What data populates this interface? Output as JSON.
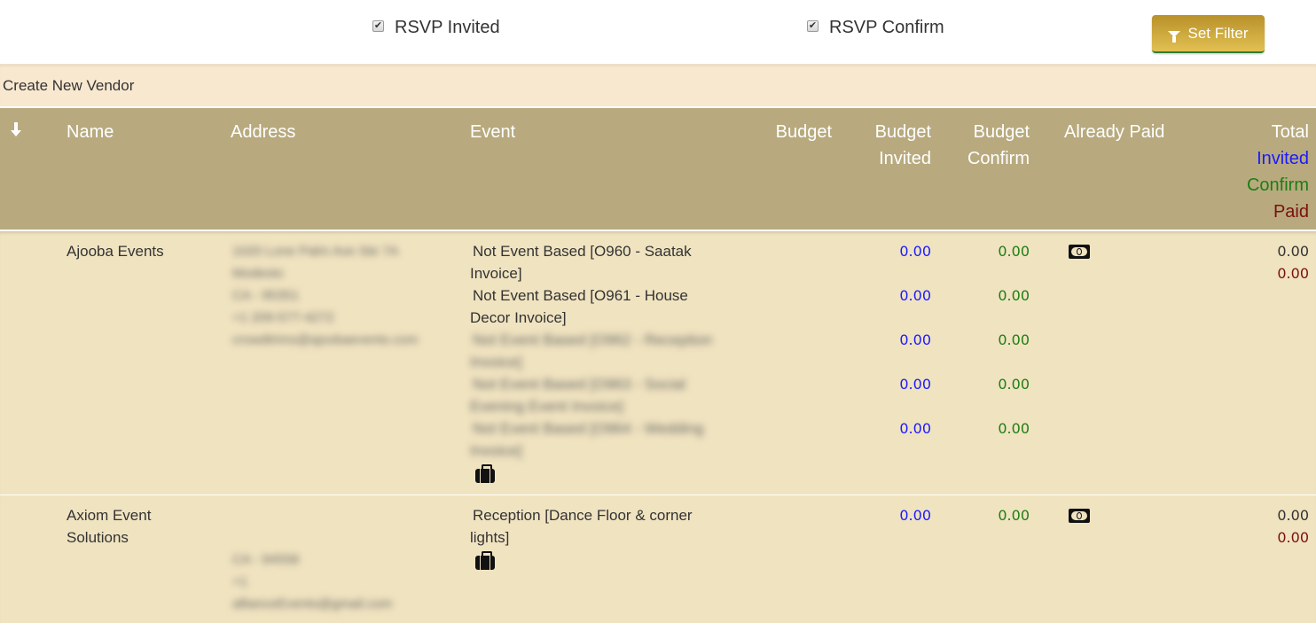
{
  "filters": {
    "rsvp_invited": {
      "label": "RSVP Invited",
      "checked": true
    },
    "rsvp_confirm": {
      "label": "RSVP Confirm",
      "checked": true
    },
    "set_filter_label": "Set Filter"
  },
  "create_vendor_label": "Create New Vendor",
  "table": {
    "headers": {
      "sort": "sort-arrow-down",
      "name": "Name",
      "address": "Address",
      "event": "Event",
      "budget": "Budget",
      "budget_invited_1": "Budget",
      "budget_invited_2": "Invited",
      "budget_confirm_1": "Budget",
      "budget_confirm_2": "Confirm",
      "already_paid": "Already Paid",
      "total": "Total",
      "total_invited": "Invited",
      "total_confirm": "Confirm",
      "total_paid": "Paid"
    },
    "colors": {
      "invited": "#1a1aff",
      "confirm": "#1e7d14",
      "paid": "#7a1010",
      "header_bg": "#b8aa7e",
      "row_bg": "#f0e3c0"
    },
    "rows": [
      {
        "name": "Ajooba Events",
        "address_blurred": true,
        "events": [
          {
            "label": "Not Event Based [O960 - Saatak Invoice]",
            "budget_invited": "0.00",
            "budget_confirm": "0.00"
          },
          {
            "label": "Not Event Based [O961 - House Decor Invoice]",
            "budget_invited": "0.00",
            "budget_confirm": "0.00"
          },
          {
            "label": "[blurred]",
            "budget_invited": "0.00",
            "budget_confirm": "0.00"
          },
          {
            "label": "[blurred]",
            "budget_invited": "0.00",
            "budget_confirm": "0.00"
          },
          {
            "label": "[blurred]",
            "budget_invited": "0.00",
            "budget_confirm": "0.00"
          }
        ],
        "total": "0.00",
        "total_paid": "0.00"
      },
      {
        "name_line1": "Axiom Event",
        "name_line2": "Solutions",
        "address_blurred": true,
        "events": [
          {
            "label_line1": "Reception [Dance Floor & corner",
            "label_line2": "lights]",
            "budget_invited": "0.00",
            "budget_confirm": "0.00"
          }
        ],
        "total": "0.00",
        "total_paid": "0.00"
      }
    ]
  },
  "row1_event_lines": {
    "e1_l1": "Not Event Based [O960 - Saatak",
    "e1_l2": "Invoice]",
    "e2_l1": "Not Event Based [O961 - House",
    "e2_l2": "Decor Invoice]",
    "e3_l1": "Not Event Based [O962 - Reception",
    "e3_l2": "Invoice]",
    "e4_l1": "Not Event Based [O963 - Social",
    "e4_l2": "Evening Event Invoice]",
    "e5_l1": "Not Event Based [O964 - Wedding",
    "e5_l2": "Invoice]"
  },
  "row1_address_lines": [
    "1020 Lone Palm Ave Ste 7A",
    "Modesto",
    "CA - 95351",
    "+1 209-577-4272",
    "crowdtrims@ajoobaevents.com"
  ],
  "row2_address_lines": [
    "CA - 94558",
    "+1",
    "allianceEvents@gmail.com"
  ]
}
